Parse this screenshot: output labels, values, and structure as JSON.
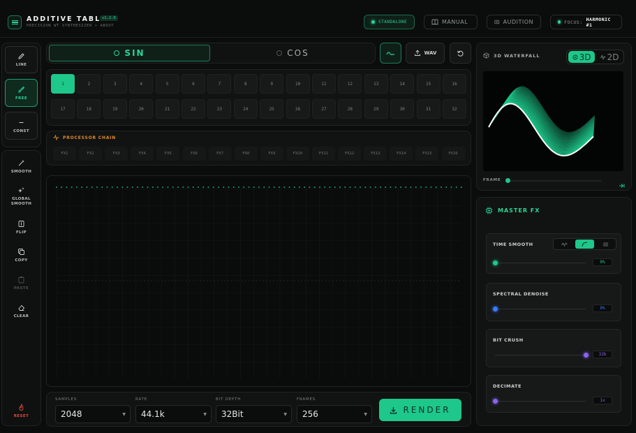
{
  "header": {
    "title": "ADDITIVE TABLE",
    "version": "v1.2.6",
    "subtitle": "PRECISION WT SYNTHESIZER • ABOUT",
    "standalone_label": "STANDALONE",
    "manual_label": "MANUAL",
    "audition_label": "AUDITION",
    "focus_prefix": "FOCUS:",
    "focus_value": "HARMONIC #1"
  },
  "tools": {
    "draw": [
      {
        "label": "LINE",
        "icon": "pencil-icon",
        "active": false
      },
      {
        "label": "FREE",
        "icon": "brush-icon",
        "active": true
      },
      {
        "label": "CONST",
        "icon": "minus-icon",
        "active": false
      }
    ],
    "actions": [
      {
        "label": "SMOOTH",
        "icon": "wand-icon"
      },
      {
        "label": "GLOBAL SMOOTH",
        "icon": "sparkle-icon"
      },
      {
        "label": "FLIP",
        "icon": "flip-icon"
      },
      {
        "label": "COPY",
        "icon": "copy-icon"
      },
      {
        "label": "PASTE",
        "icon": "clipboard-icon"
      },
      {
        "label": "CLEAR",
        "icon": "eraser-icon"
      }
    ],
    "reset_label": "RESET"
  },
  "wave": {
    "sin_label": "SIN",
    "cos_label": "COS",
    "selected": "SIN",
    "wav_label": "WAV"
  },
  "harmonics": {
    "active": 1,
    "row1": [
      "1",
      "2",
      "3",
      "4",
      "5",
      "6",
      "7",
      "8",
      "9",
      "10",
      "11",
      "12",
      "13",
      "14",
      "15",
      "16"
    ],
    "row2": [
      "17",
      "18",
      "19",
      "20",
      "21",
      "22",
      "23",
      "24",
      "25",
      "26",
      "27",
      "28",
      "29",
      "30",
      "31",
      "32"
    ]
  },
  "chain": {
    "title": "PROCESSOR CHAIN",
    "slots": [
      "FX1",
      "FX2",
      "FX3",
      "FX4",
      "FX5",
      "FX6",
      "FX7",
      "FX8",
      "FX9",
      "FX10",
      "FX11",
      "FX12",
      "FX13",
      "FX14",
      "FX15",
      "FX16"
    ]
  },
  "settings": {
    "samples_label": "SAMPLES",
    "samples_value": "2048",
    "rate_label": "RATE",
    "rate_value": "44.1k",
    "depth_label": "BIT DEPTH",
    "depth_value": "32Bit",
    "frames_label": "FRAMES",
    "frames_value": "256",
    "render_label": "RENDER"
  },
  "waterfall": {
    "title": "3D WATERFALL",
    "mode_3d": "3D",
    "mode_2d": "2D",
    "selected_mode": "3D",
    "frame_label": "FRAME",
    "frame_position": 0.0
  },
  "master_fx": {
    "title": "MASTER FX",
    "time_smooth": {
      "label": "TIME SMOOTH",
      "value": "0%",
      "level": 0.0,
      "color": "#1ec78a",
      "selected_curve": 1
    },
    "spectral_denoise": {
      "label": "SPECTRAL DENOISE",
      "value": "0%",
      "level": 0.0,
      "color": "#3a7bff"
    },
    "bit_crush": {
      "label": "BIT CRUSH",
      "value": "32b",
      "level": 1.0,
      "color": "#8a63f0"
    },
    "decimate": {
      "label": "DECIMATE",
      "value": "1x",
      "level": 0.0,
      "color": "#8a63f0"
    }
  },
  "colors": {
    "accent": "#1ec78a",
    "danger": "#e24a3f",
    "processor": "#e08a2a"
  }
}
